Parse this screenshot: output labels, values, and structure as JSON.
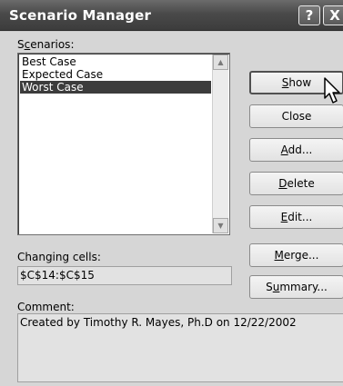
{
  "window": {
    "title": "Scenario Manager",
    "help_label": "?",
    "close_label": "X"
  },
  "scenarios": {
    "label_pre": "S",
    "label_underline": "c",
    "label_post": "enarios:",
    "items": [
      "Best Case",
      "Expected Case",
      "Worst Case"
    ],
    "selected_index": 2
  },
  "changing_cells": {
    "label": "Changing cells:",
    "value": "$C$14:$C$15"
  },
  "comment": {
    "label": "Comment:",
    "value": "Created by Timothy R. Mayes, Ph.D on 12/22/2002"
  },
  "buttons": {
    "show": {
      "pre": "",
      "u": "S",
      "post": "how"
    },
    "close": {
      "pre": "Close",
      "u": "",
      "post": ""
    },
    "add": {
      "pre": "",
      "u": "A",
      "post": "dd..."
    },
    "delete": {
      "pre": "",
      "u": "D",
      "post": "elete"
    },
    "edit": {
      "pre": "",
      "u": "E",
      "post": "dit..."
    },
    "merge": {
      "pre": "",
      "u": "M",
      "post": "erge..."
    },
    "summary": {
      "pre": "S",
      "u": "u",
      "post": "mmary..."
    }
  }
}
